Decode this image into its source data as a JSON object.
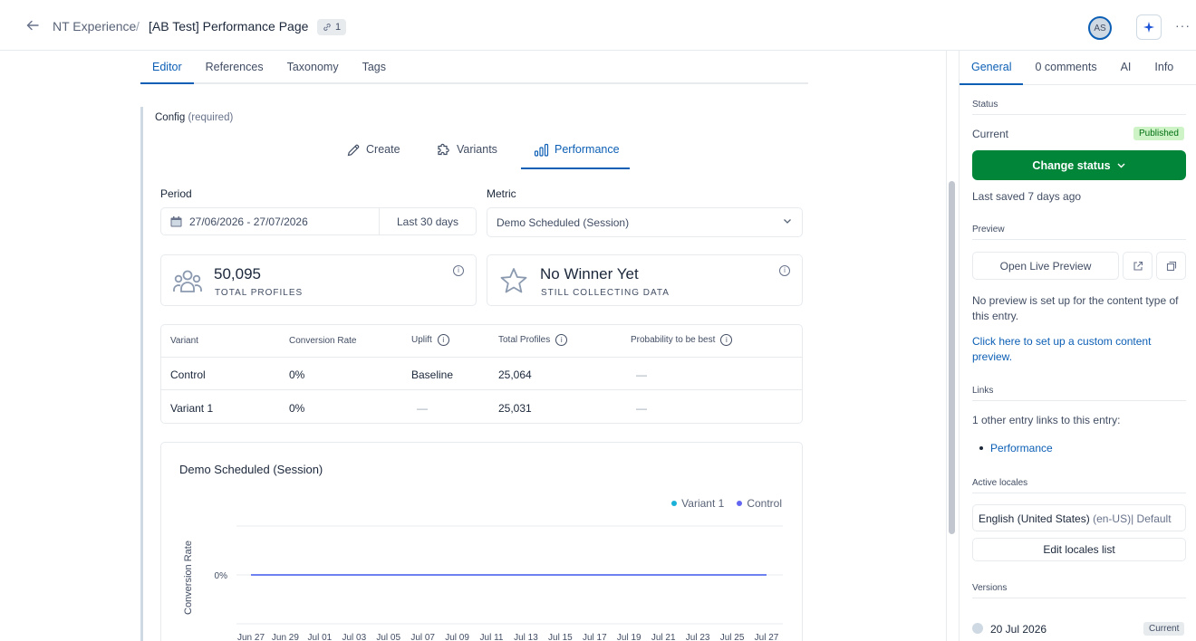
{
  "header": {
    "space_name": "NT Experience",
    "separator": "/",
    "entry_title": "[AB Test] Performance Page",
    "references_count": "1",
    "avatar_initials": "AS",
    "more_label": "···"
  },
  "editor_tabs": [
    "Editor",
    "References",
    "Taxonomy",
    "Tags"
  ],
  "config": {
    "label": "Config",
    "required": "(required)",
    "subtabs": [
      "Create",
      "Variants",
      "Performance"
    ]
  },
  "period": {
    "label": "Period",
    "date_range": "27/06/2026 - 27/07/2026",
    "preset": "Last 30 days"
  },
  "metric": {
    "label": "Metric",
    "selected": "Demo Scheduled (Session)"
  },
  "stats": {
    "profiles_value": "50,095",
    "profiles_label": "TOTAL PROFILES",
    "winner_value": "No Winner Yet",
    "winner_label": "STILL COLLECTING DATA"
  },
  "table": {
    "headers": [
      "Variant",
      "Conversion Rate",
      "Uplift",
      "Total Profiles",
      "Probability to be best"
    ],
    "rows": [
      [
        "Control",
        "0%",
        "Baseline",
        "25,064",
        "—"
      ],
      [
        "Variant 1",
        "0%",
        "—",
        "25,031",
        "—"
      ]
    ]
  },
  "chart_data": {
    "type": "line",
    "title": "Demo Scheduled (Session)",
    "ylabel": "Conversion Rate",
    "xlabel": "",
    "y_tick_labels": [
      "0%"
    ],
    "x": [
      "Jun 27",
      "Jun 29",
      "Jul 01",
      "Jul 03",
      "Jul 05",
      "Jul 07",
      "Jul 09",
      "Jul 11",
      "Jul 13",
      "Jul 15",
      "Jul 17",
      "Jul 19",
      "Jul 21",
      "Jul 23",
      "Jul 25",
      "Jul 27"
    ],
    "series": [
      {
        "name": "Variant 1",
        "color": "#1ab1d8",
        "values": [
          0,
          0,
          0,
          0,
          0,
          0,
          0,
          0,
          0,
          0,
          0,
          0,
          0,
          0,
          0,
          0
        ]
      },
      {
        "name": "Control",
        "color": "#6366f1",
        "values": [
          0,
          0,
          0,
          0,
          0,
          0,
          0,
          0,
          0,
          0,
          0,
          0,
          0,
          0,
          0,
          0
        ]
      }
    ],
    "ylim": [
      -1,
      1
    ],
    "grid": true,
    "legend": "top-right"
  },
  "sidebar": {
    "tabs": [
      "General",
      "0 comments",
      "AI",
      "Info"
    ],
    "status_heading": "Status",
    "current_label": "Current",
    "status_badge": "Published",
    "change_status": "Change status",
    "last_saved": "Last saved 7 days ago",
    "preview_heading": "Preview",
    "open_preview": "Open Live Preview",
    "no_preview": "No preview is set up for the content type of this entry.",
    "setup_link": "Click here to set up a custom content preview.",
    "links_heading": "Links",
    "links_text": "1 other entry links to this entry:",
    "linked_entry": "Performance",
    "locales_heading": "Active locales",
    "locale_name": "English (United States)",
    "locale_code": "(en-US)| Default",
    "edit_locales": "Edit locales list",
    "versions_heading": "Versions",
    "version_date": "20 Jul 2026",
    "version_badge": "Current"
  },
  "colors": {
    "accent": "#0c5fb5",
    "publish_green": "#008539",
    "variant_color": "#1ab1d8",
    "control_color": "#6366f1"
  }
}
